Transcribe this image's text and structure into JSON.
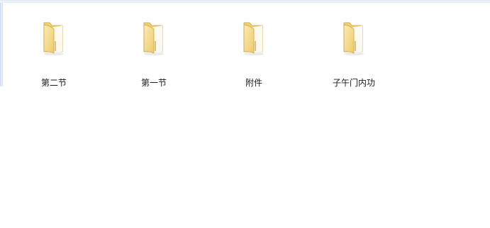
{
  "folders": [
    {
      "name": "第二节",
      "icon": "folder-icon"
    },
    {
      "name": "第一节",
      "icon": "folder-icon"
    },
    {
      "name": "附件",
      "icon": "folder-icon"
    },
    {
      "name": "子午门内功",
      "icon": "folder-icon"
    }
  ],
  "colors": {
    "folder_back": "#e8c766",
    "folder_front": "#f6de93",
    "folder_edge": "#c9a445",
    "background": "#ffffff"
  }
}
